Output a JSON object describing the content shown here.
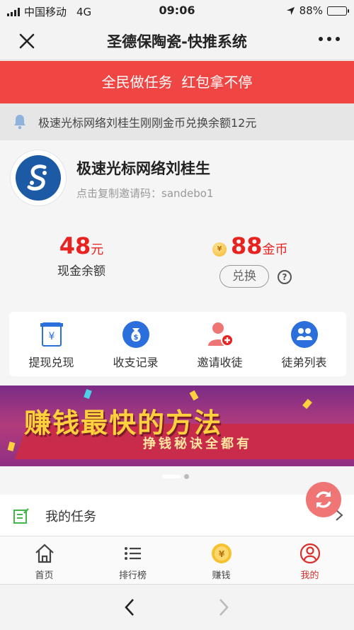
{
  "status_bar": {
    "carrier": "中国移动",
    "network": "4G",
    "time": "09:06",
    "battery": "88%",
    "battery_level": 0.88
  },
  "navbar": {
    "title": "圣德保陶瓷-快推系统",
    "close_icon": "close-icon",
    "more_icon": "more-icon"
  },
  "banner": {
    "text": "全民做任务  红包拿不停",
    "color": "#ef4644"
  },
  "notice": {
    "icon": "bell-icon",
    "text": "极速光标网络刘桂生刚刚金币兑换余额12元"
  },
  "profile": {
    "name": "极速光标网络刘桂生",
    "invite_text": "点击复制邀请码：sandebo1"
  },
  "balance": {
    "cash_amount": "48",
    "cash_unit": "元",
    "cash_label": "现金余额",
    "coin_amount": "88",
    "coin_unit": "金币",
    "coin_symbol": "¥",
    "exchange_label": "兑换",
    "help_symbol": "?"
  },
  "actions": [
    {
      "label": "提现兑现",
      "icon": "withdraw-icon"
    },
    {
      "label": "收支记录",
      "icon": "money-bag-icon"
    },
    {
      "label": "邀请收徒",
      "icon": "add-user-icon"
    },
    {
      "label": "徒弟列表",
      "icon": "users-icon"
    }
  ],
  "promo": {
    "title": "赚钱最快的方法",
    "subtitle": "挣钱秘诀全都有"
  },
  "task": {
    "label": "我的任务",
    "icon": "task-edit-icon"
  },
  "tabs": [
    {
      "label": "首页",
      "icon": "home-icon",
      "active": false
    },
    {
      "label": "排行榜",
      "icon": "list-icon",
      "active": false
    },
    {
      "label": "赚钱",
      "icon": "coin-icon",
      "active": false
    },
    {
      "label": "我的",
      "icon": "user-icon",
      "active": true
    }
  ],
  "colors": {
    "accent_red": "#e8231f",
    "tab_active": "#d9302c",
    "action_blue": "#2a6fdb"
  }
}
